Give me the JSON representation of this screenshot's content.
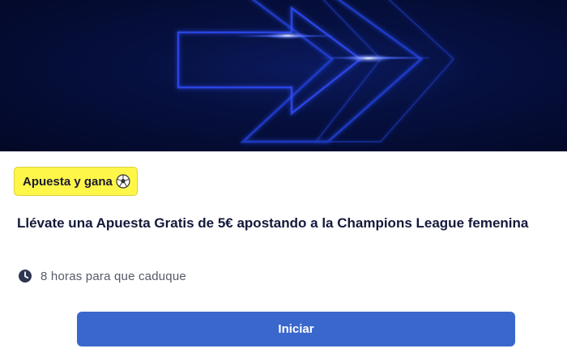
{
  "hero": {
    "image": "champions-league-arrows-banner"
  },
  "badge": {
    "label": "Apuesta y gana",
    "icon": "soccer-ball-icon",
    "background": "#fff64a"
  },
  "promo": {
    "title": "Llévate una Apuesta Gratis de 5€ apostando a la Champions League femenina"
  },
  "expiry": {
    "icon": "clock-icon",
    "text": "8 horas para que caduque"
  },
  "cta": {
    "label": "Iniciar",
    "color": "#3a67cc"
  },
  "colors": {
    "hero_background": "#06103f",
    "hero_glow": "#2a4cff",
    "title_text": "#14193a"
  }
}
